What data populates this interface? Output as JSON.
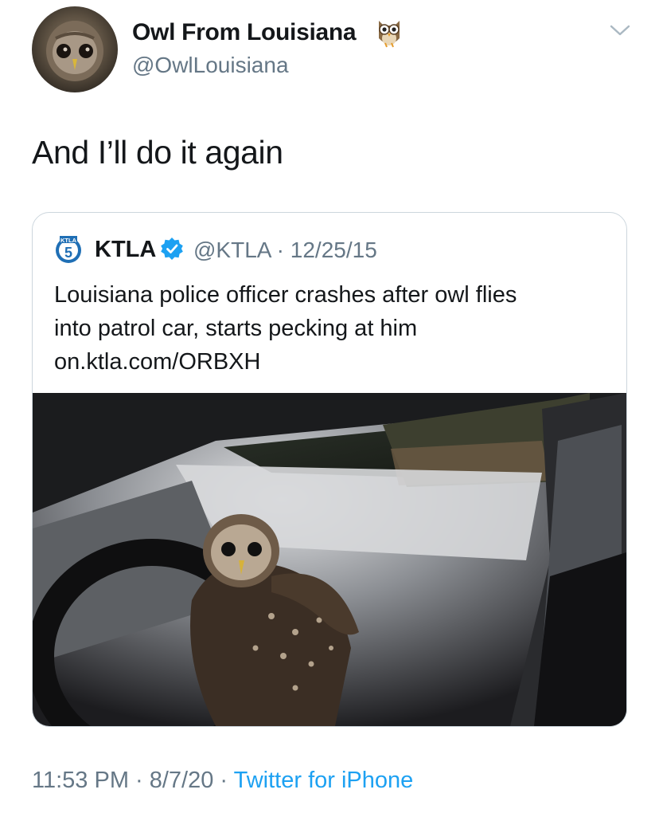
{
  "author": {
    "display_name": "Owl From Louisiana",
    "handle": "@OwlLouisiana",
    "avatar_icon": "owl-avatar",
    "name_emoji_icon": "owl-emoji-icon"
  },
  "tweet": {
    "text": "And I’ll do it again"
  },
  "quoted_tweet": {
    "logo_text": "KTLA",
    "logo_number": "5",
    "name": "KTLA",
    "verified": true,
    "handle_date": "@KTLA · 12/25/15",
    "text_line1": "Louisiana police officer crashes after owl flies",
    "text_line2": "into patrol car, starts pecking at him",
    "link": "on.ktla.com/ORBXH",
    "media_icon": "owl-in-patrol-car-photo"
  },
  "footer": {
    "time_date": "11:53 PM · 8/7/20 · ",
    "source": "Twitter for iPhone"
  },
  "colors": {
    "secondary_text": "#657786",
    "link": "#1da1f2",
    "verified": "#1da1f2",
    "border": "#ccd6dd"
  }
}
